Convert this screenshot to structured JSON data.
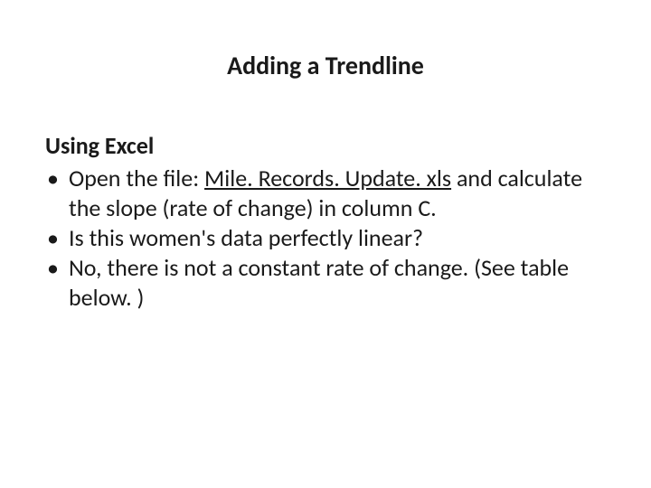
{
  "title": "Adding a Trendline",
  "subheading": "Using Excel",
  "bullets": [
    {
      "prefix": "Open the file:  ",
      "link": "Mile. Records. Update. xls",
      "suffix": " and calculate the slope (rate of change) in column C."
    },
    {
      "text": "Is this women's data perfectly linear?"
    },
    {
      "text": "No, there is not a constant rate of change. (See table below. )"
    }
  ]
}
